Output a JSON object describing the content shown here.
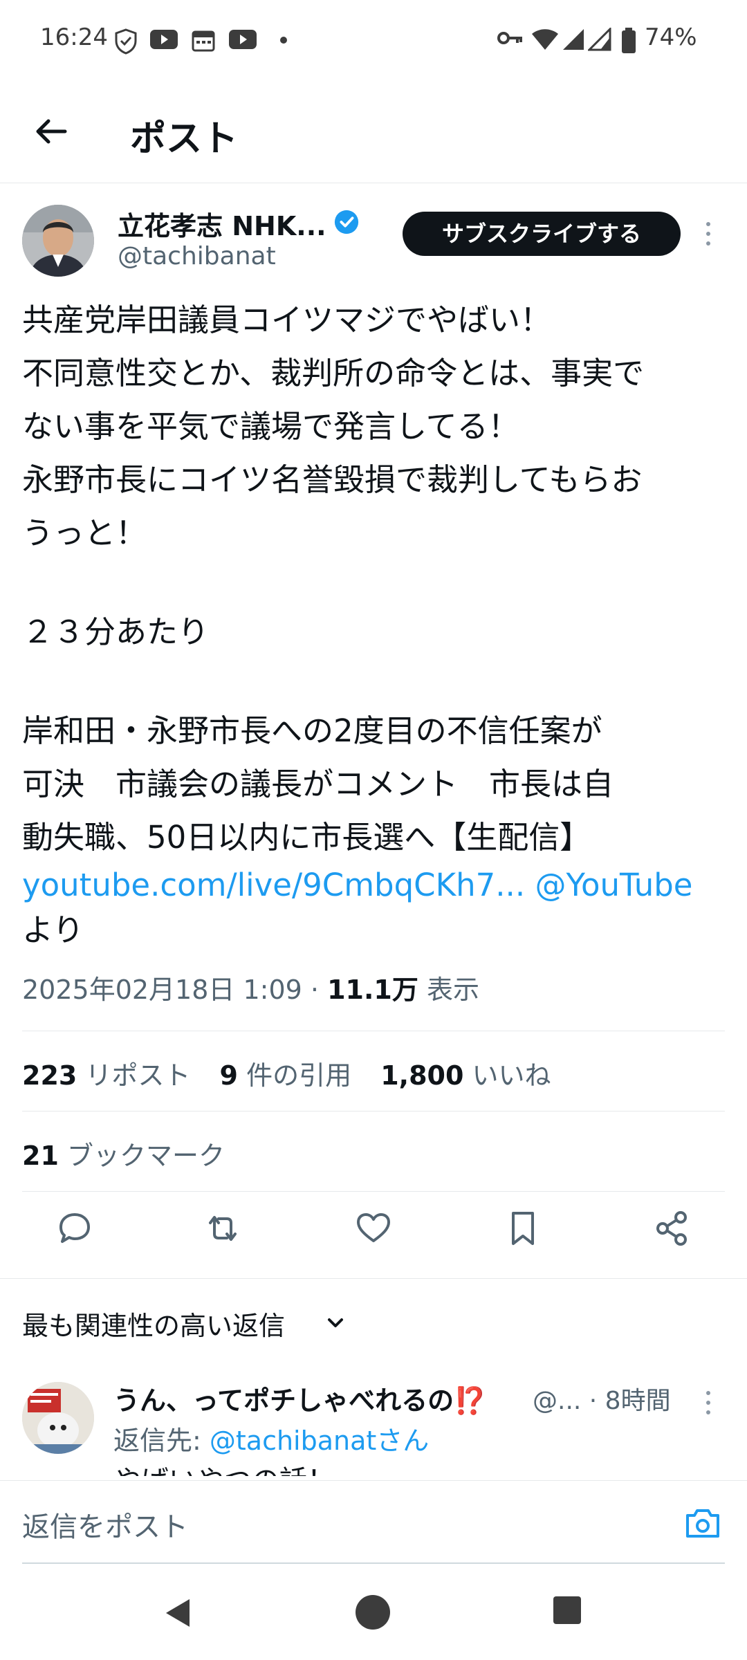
{
  "status_bar": {
    "time": "16:24",
    "battery": "74%",
    "icons": [
      "shield-icon",
      "youtube-icon",
      "calendar-icon",
      "youtube-icon",
      "dot-icon",
      "key-icon",
      "wifi-icon",
      "signal-icon",
      "signal-icon",
      "battery-icon"
    ]
  },
  "header": {
    "title": "ポスト"
  },
  "post": {
    "author_name": "立花孝志 NHK...",
    "handle": "@tachibanat",
    "subscribe_label": "サブスクライブする",
    "lines": [
      "共産党岸田議員コイツマジでやばい！",
      "不同意性交とか、裁判所の命令とは、事実で",
      "ない事を平気で議場で発言してる！",
      "永野市長にコイツ名誉毀損で裁判してもらお",
      "うっと！"
    ],
    "time_mark": "２３分あたり",
    "news_lines": [
      "岸和田・永野市長への2度目の不信任案が",
      "可決　市議会の議長がコメント　市長は自",
      "動失職、50日以内に市長選へ【生配信】"
    ],
    "link_url": "youtube.com/live/9CmbqCKh7...",
    "link_mention": "@YouTube",
    "link_suffix": "より",
    "date": "2025年02月18日 1:09",
    "dot": "·",
    "views_count": "11.1万",
    "views_label": "表示",
    "reposts_count": "223",
    "reposts_label": "リポスト",
    "quotes_count": "9",
    "quotes_label": "件の引用",
    "likes_count": "1,800",
    "likes_label": "いいね",
    "bookmarks_count": "21",
    "bookmarks_label": "ブックマーク"
  },
  "replies": {
    "sort_label": "最も関連性の高い返信",
    "items": [
      {
        "name": "うん、ってポチしゃべれるの⁉️",
        "handle": "@...",
        "time": "· 8時間",
        "reply_to_prefix": "返信先: ",
        "reply_to_user": "@tachibanatさん",
        "text": "やばいやつの話！"
      }
    ]
  },
  "composer": {
    "placeholder": "返信をポスト"
  },
  "colors": {
    "accent": "#1d9bf0",
    "text": "#0f1419",
    "muted": "#536471"
  }
}
